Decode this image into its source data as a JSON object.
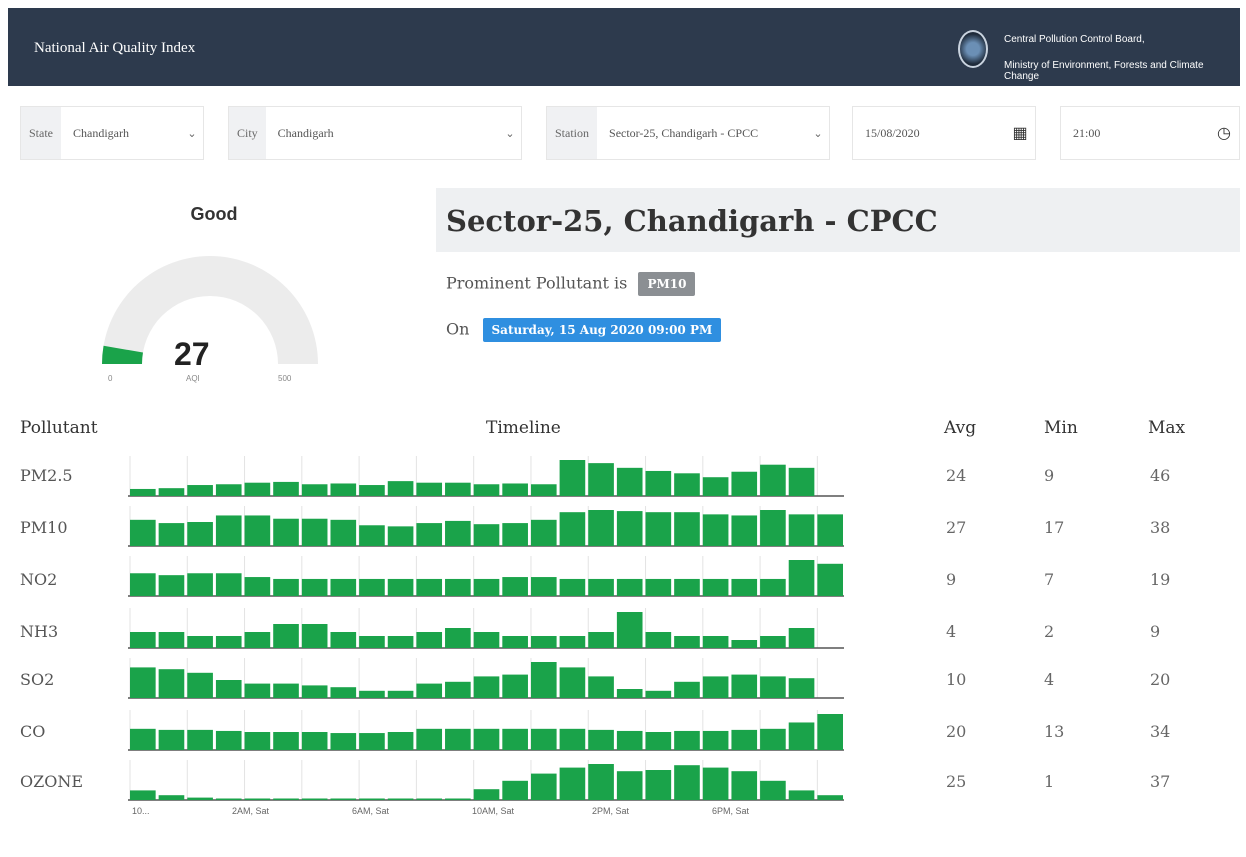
{
  "header": {
    "title": "National Air Quality Index",
    "org_line1": "Central Pollution Control Board,",
    "org_line2": "Ministry of Environment, Forests and Climate Change"
  },
  "filters": {
    "state_label": "State",
    "state_value": "Chandigarh",
    "city_label": "City",
    "city_value": "Chandigarh",
    "station_label": "Station",
    "station_value": "Sector-25, Chandigarh - CPCC",
    "date_value": "15/08/2020",
    "time_value": "21:00"
  },
  "gauge": {
    "category": "Good",
    "value": "27",
    "min_label": "0",
    "unit_label": "AQI",
    "max_label": "500",
    "fill_fraction": 0.054,
    "color": "#1aa34a"
  },
  "station": {
    "name": "Sector-25, Chandigarh - CPCC",
    "prominent_text": "Prominent Pollutant is",
    "prominent_value": "PM10",
    "on_text": "On",
    "datetime": "Saturday, 15 Aug 2020 09:00 PM"
  },
  "table": {
    "col_pollutant": "Pollutant",
    "col_timeline": "Timeline",
    "col_avg": "Avg",
    "col_min": "Min",
    "col_max": "Max",
    "rows": [
      {
        "name": "PM2.5",
        "avg": "24",
        "min": "9",
        "max": "46"
      },
      {
        "name": "PM10",
        "avg": "27",
        "min": "17",
        "max": "38"
      },
      {
        "name": "NO2",
        "avg": "9",
        "min": "7",
        "max": "19"
      },
      {
        "name": "NH3",
        "avg": "4",
        "min": "2",
        "max": "9"
      },
      {
        "name": "SO2",
        "avg": "10",
        "min": "4",
        "max": "20"
      },
      {
        "name": "CO",
        "avg": "20",
        "min": "13",
        "max": "34"
      },
      {
        "name": "OZONE",
        "avg": "25",
        "min": "1",
        "max": "37"
      }
    ]
  },
  "chart_data": {
    "type": "bar",
    "bar_color": "#1aa34a",
    "x_tick_labels": [
      "10...",
      "2AM, Sat",
      "6AM, Sat",
      "10AM, Sat",
      "2PM, Sat",
      "6PM, Sat"
    ],
    "series": [
      {
        "name": "PM2.5",
        "values": [
          9,
          10,
          14,
          15,
          17,
          18,
          15,
          16,
          14,
          19,
          17,
          17,
          15,
          16,
          15,
          46,
          42,
          36,
          32,
          29,
          24,
          31,
          40,
          36
        ]
      },
      {
        "name": "PM10",
        "values": [
          24,
          21,
          22,
          28,
          28,
          25,
          25,
          24,
          19,
          18,
          21,
          23,
          20,
          21,
          24,
          31,
          33,
          32,
          31,
          31,
          29,
          28,
          33,
          29,
          29
        ]
      },
      {
        "name": "NO2",
        "values": [
          12,
          11,
          12,
          12,
          10,
          9,
          9,
          9,
          9,
          9,
          9,
          9,
          9,
          10,
          10,
          9,
          9,
          9,
          9,
          9,
          9,
          9,
          9,
          19,
          17
        ]
      },
      {
        "name": "NH3",
        "values": [
          4,
          4,
          3,
          3,
          4,
          6,
          6,
          4,
          3,
          3,
          4,
          5,
          4,
          3,
          3,
          3,
          4,
          9,
          4,
          3,
          3,
          2,
          3,
          5
        ]
      },
      {
        "name": "SO2",
        "values": [
          17,
          16,
          14,
          10,
          8,
          8,
          7,
          6,
          4,
          4,
          8,
          9,
          12,
          13,
          20,
          17,
          12,
          5,
          4,
          9,
          12,
          13,
          12,
          11
        ]
      },
      {
        "name": "CO",
        "values": [
          20,
          19,
          19,
          18,
          17,
          17,
          17,
          16,
          16,
          17,
          20,
          20,
          20,
          20,
          20,
          20,
          19,
          18,
          17,
          18,
          18,
          19,
          20,
          26,
          34
        ]
      },
      {
        "name": "OZONE",
        "values": [
          8,
          4,
          2,
          1,
          1,
          1,
          1,
          1,
          1,
          1,
          1,
          1,
          9,
          16,
          22,
          27,
          30,
          24,
          25,
          29,
          27,
          24,
          16,
          8,
          4
        ]
      }
    ]
  }
}
